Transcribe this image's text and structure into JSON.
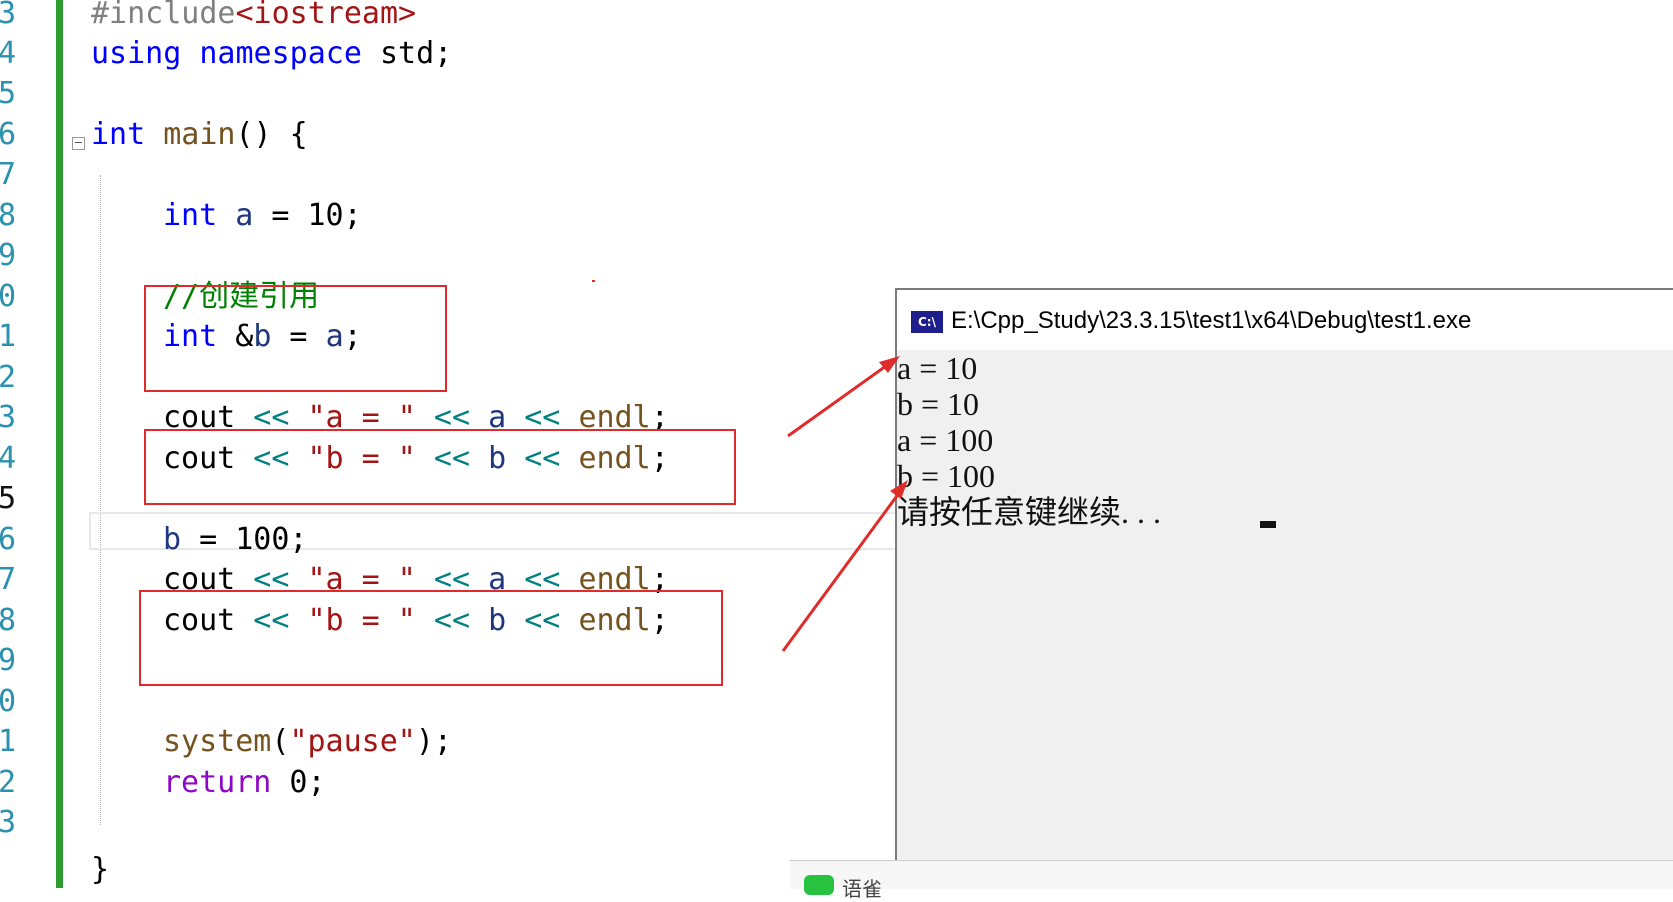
{
  "editor": {
    "line_numbers": [
      "3",
      "4",
      "5",
      "6",
      "7",
      "8",
      "9",
      "0",
      "1",
      "2",
      "3",
      "4",
      "5",
      "6",
      "7",
      "8",
      "9",
      "0",
      "1",
      "2",
      "3"
    ],
    "current_line_index": 12,
    "lines": {
      "l3_pp": "#include",
      "l3_inc": "<iostream>",
      "l4_using": "using",
      "l4_namespace": "namespace",
      "l4_rest": " std;",
      "l6_int": "int",
      "l6_main": " main",
      "l6_rest": "() {",
      "l8_int": "int",
      "l8_a": " a",
      "l8_rest": " = 10;",
      "l10_comment": "//创建引用",
      "l11_int": "int",
      "l11_amp": " &",
      "l11_b": "b",
      "l11_eq": " = ",
      "l11_a": "a",
      "l11_semi": ";",
      "cout": "cout",
      "shl": " << ",
      "str_a": "\"a = \"",
      "str_b": "\"b = \"",
      "var_a": "a",
      "var_b": "b",
      "endl": "endl",
      "semi": ";",
      "l16_b": "b",
      "l16_rest": " = 100;",
      "l21_system": "system",
      "l21_open": "(",
      "l21_str": "\"pause\"",
      "l21_close": ");",
      "l22_return": "return",
      "l22_rest": " 0;",
      "l23_brace": "}"
    },
    "collapse_glyph": "−"
  },
  "console": {
    "icon_text": "C:\\",
    "title": "E:\\Cpp_Study\\23.3.15\\test1\\x64\\Debug\\test1.exe",
    "output": [
      "a = 10",
      "b = 10",
      "a = 100",
      "b = 100",
      "请按任意键继续. . ."
    ]
  },
  "popup": {
    "label": "语雀"
  },
  "colors": {
    "annotation_red": "#e02b2b",
    "gutter_green": "#2e9c2e",
    "console_bg": "#f0f0f0"
  }
}
